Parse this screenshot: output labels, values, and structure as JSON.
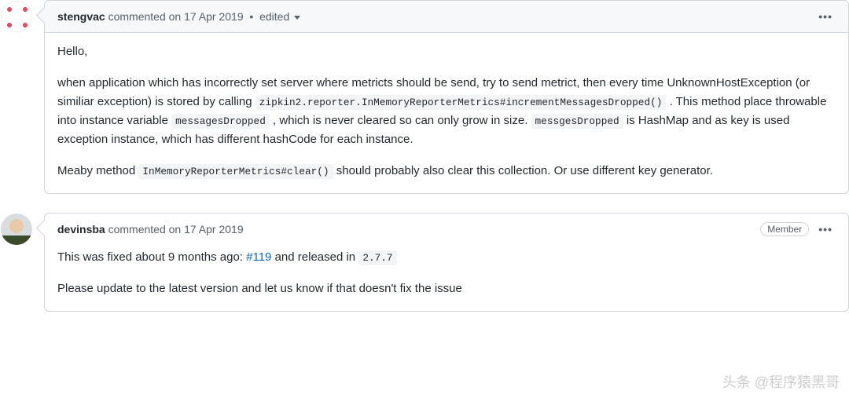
{
  "comments": [
    {
      "author": "stengvac",
      "action": "commented",
      "on": "on",
      "date": "17 Apr 2019",
      "edited": "edited",
      "badge": null,
      "body": {
        "greeting": "Hello,",
        "p1_a": "when application which has incorrectly set server where metricts should be send, try to send metrict, then every time UnknownHostException (or similiar exception) is stored by calling ",
        "code1": "zipkin2.reporter.InMemoryReporterMetrics#incrementMessagesDropped()",
        "p1_b": ". This method place throwable into instance variable ",
        "code2": "messagesDropped",
        "p1_c": ", which is never cleared so can only grow in size. ",
        "code3": "messgesDropped",
        "p1_d": " is HashMap and as key is used exception instance, which has different hashCode for each instance.",
        "p2_a": "Meaby method ",
        "code4": "InMemoryReporterMetrics#clear()",
        "p2_b": " should probably also clear this collection. Or use different key generator."
      }
    },
    {
      "author": "devinsba",
      "action": "commented",
      "on": "on",
      "date": "17 Apr 2019",
      "edited": null,
      "badge": "Member",
      "body": {
        "p1_a": "This was fixed about 9 months ago: ",
        "link_text": "#119",
        "p1_b": " and released in ",
        "code1": "2.7.7",
        "p2": "Please update to the latest version and let us know if that doesn't fix the issue"
      }
    }
  ],
  "watermark": "头条 @程序猿黑哥"
}
